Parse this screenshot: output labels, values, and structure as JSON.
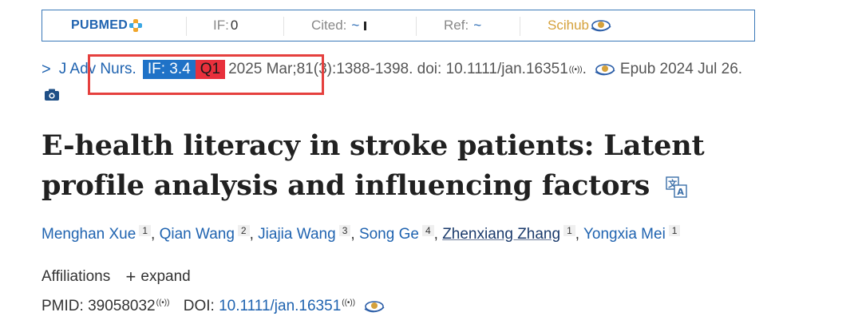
{
  "topbar": {
    "pubmed_label": "PUBMED",
    "if_label": "IF:",
    "if_value": "0",
    "cited_label": "Cited:",
    "cited_value": "~",
    "ref_label": "Ref:",
    "ref_value": "~",
    "scihub_label": "Scihub"
  },
  "journal": {
    "chevron": ">",
    "name": "J Adv Nurs.",
    "if_badge": "IF: 3.4",
    "quartile": "Q1",
    "citation": "2025 Mar;81(3):1388-1398. doi: 10.1111/jan.16351",
    "epub": "Epub 2024 Jul 26."
  },
  "article": {
    "title": "E-health literacy in stroke patients: Latent profile analysis and influencing factors"
  },
  "authors": [
    {
      "name": "Menghan Xue",
      "aff": "1"
    },
    {
      "name": "Qian Wang",
      "aff": "2"
    },
    {
      "name": "Jiajia Wang",
      "aff": "3"
    },
    {
      "name": "Song Ge",
      "aff": "4"
    },
    {
      "name": "Zhenxiang Zhang",
      "aff": "1"
    },
    {
      "name": "Yongxia Mei",
      "aff": "1"
    }
  ],
  "affiliations": {
    "label": "Affiliations",
    "expand_label": "expand"
  },
  "ids": {
    "pmid_label": "PMID:",
    "pmid_value": "39058032",
    "doi_label": "DOI:",
    "doi_value": "10.1111/jan.16351"
  },
  "colors": {
    "accent_blue": "#1f63b0",
    "if_badge_bg": "#1f72c7",
    "q_badge_bg": "#e8303c",
    "highlight_border": "#e5403e",
    "scihub_gold": "#d5a13b"
  }
}
